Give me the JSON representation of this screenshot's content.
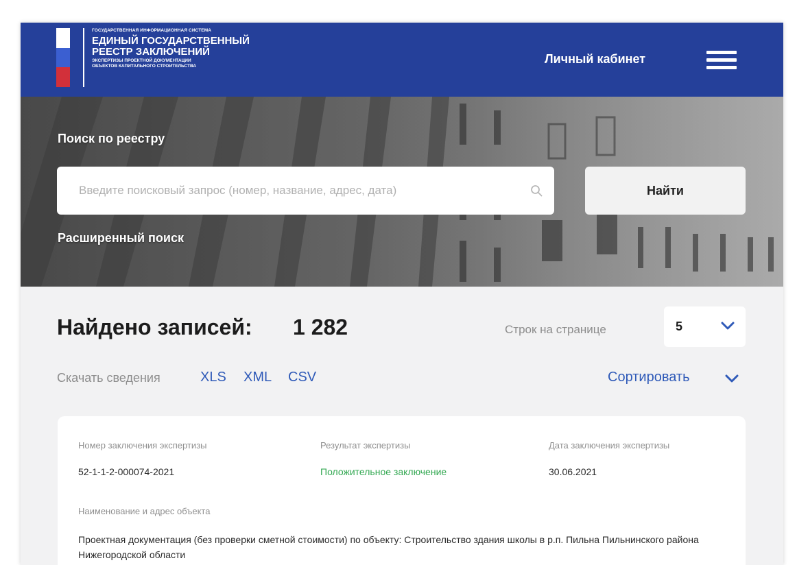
{
  "header": {
    "logo_line1": "ГОСУДАРСТВЕННАЯ ИНФОРМАЦИОННАЯ СИСТЕМА",
    "logo_line2": "ЕДИНЫЙ ГОСУДАРСТВЕННЫЙ",
    "logo_line3": "РЕЕСТР ЗАКЛЮЧЕНИЙ",
    "logo_line4": "ЭКСПЕРТИЗЫ ПРОЕКТНОЙ ДОКУМЕНТАЦИИ",
    "logo_line5": "ОБЪЕКТОВ КАПИТАЛЬНОГО СТРОИТЕЛЬСТВА",
    "cabinet_label": "Личный кабинет",
    "menu_icon": "hamburger-menu-icon",
    "colors": {
      "background": "#25409a",
      "flag_white": "#ffffff",
      "flag_blue": "#3b5fd1",
      "flag_red": "#d2303a"
    }
  },
  "search": {
    "title": "Поиск по реестру",
    "placeholder": "Введите поисковый запрос (номер, название, адрес, дата)",
    "value": "",
    "search_icon": "search-icon",
    "button_label": "Найти",
    "advanced_label": "Расширенный поиск"
  },
  "results": {
    "found_label": "Найдено записей:",
    "found_count": "1 282",
    "rows_label": "Строк на странице",
    "rows_value": "5",
    "download_label": "Скачать сведения",
    "downloads": [
      "XLS",
      "XML",
      "CSV"
    ],
    "sort_label": "Сортировать",
    "link_color": "#2f5ab8"
  },
  "card": {
    "number_label": "Номер заключения экспертизы",
    "number_value": "52-1-1-2-000074-2021",
    "result_label": "Результат экспертизы",
    "result_value": "Положительное заключение",
    "result_color": "#33a852",
    "date_label": "Дата заключения экспертизы",
    "date_value": "30.06.2021",
    "address_label": "Наименование и адрес объекта",
    "address_value": "Проектная документация (без проверки сметной стоимости) по объекту: Строительство здания школы в р.п. Пильна Пильнинского района Нижегородской области"
  }
}
